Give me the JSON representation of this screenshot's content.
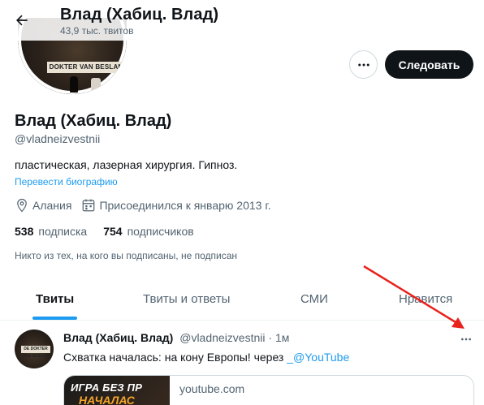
{
  "header": {
    "title": "Влад (Хабиц. Влад)",
    "subtitle": "43,9 тыс. твитов"
  },
  "profile": {
    "avatar_sign_text": "DOKTER VAN BESLAN",
    "follow_label": "Следовать",
    "name": "Влад (Хабиц. Влад)",
    "handle": "@vladneizvestnii",
    "bio": "пластическая, лазерная хирургия. Гипноз.",
    "translate_label": "Перевести биографию",
    "location": "Алания",
    "joined": "Присоединился к январю 2013 г.",
    "following_count": "538",
    "following_label": "подписка",
    "followers_count": "754",
    "followers_label": "подписчиков",
    "mutual_note": "Никто из тех, на кого вы подписаны, не подписан"
  },
  "tabs": [
    {
      "label": "Твиты",
      "active": true
    },
    {
      "label": "Твиты и ответы",
      "active": false
    },
    {
      "label": "СМИ",
      "active": false
    },
    {
      "label": "Нравится",
      "active": false
    }
  ],
  "tweet": {
    "author_name": "Влад (Хабиц. Влад)",
    "author_handle": "@vladneizvestnii",
    "time": "· 1м",
    "avatar_sign_text": "DE DOKTER VAN BESLAN",
    "text": "Схватка началась: на кону Европы!  через ",
    "link_text": "_@YouTube",
    "card": {
      "thumb_line1": "ИГРА БЕЗ ПР",
      "thumb_line2": "НАЧАЛАС",
      "domain": "youtube.com"
    }
  },
  "annotation": {
    "arrow_color": "#e8231e"
  },
  "colors": {
    "accent": "#1d9bf0",
    "text_primary": "#0f1419",
    "text_secondary": "#536471",
    "button_dark": "#0f1419"
  },
  "icons": {
    "back": "arrow-left-icon",
    "more": "more-horizontal-icon",
    "location": "location-pin-icon",
    "calendar": "calendar-icon"
  }
}
